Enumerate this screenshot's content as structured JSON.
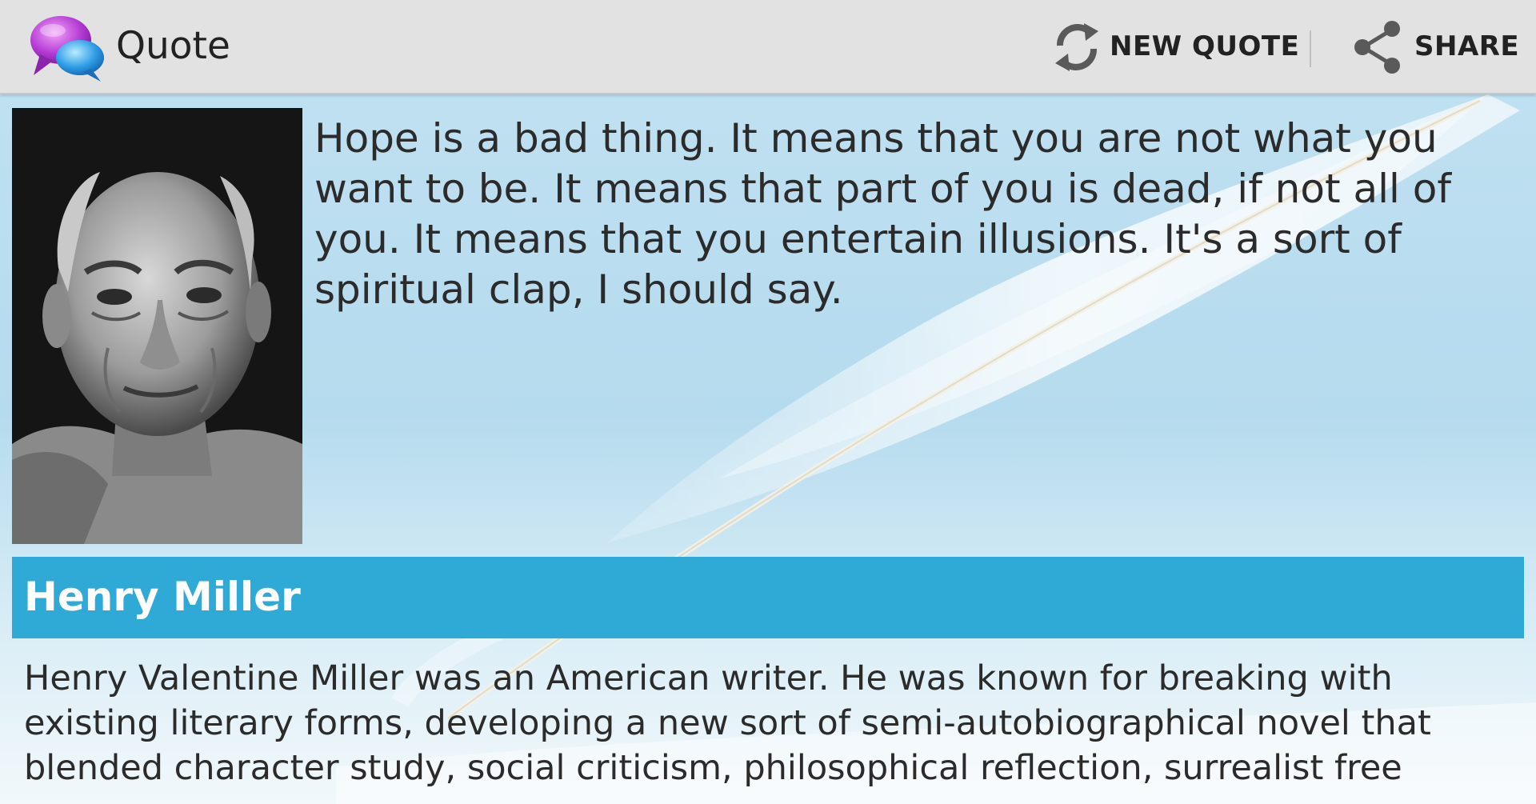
{
  "action_bar": {
    "title": "Quote",
    "new_quote_label": "NEW QUOTE",
    "share_label": "SHARE",
    "icons": {
      "app": "chat-bubbles-icon",
      "new_quote": "refresh-icon",
      "share": "share-icon"
    }
  },
  "quote": {
    "text": "Hope is a bad thing. It means that you are not what you want to be. It means that part of you is dead, if not all of you. It means that you entertain illusions. It's a sort of spiritual clap, I should say."
  },
  "author": {
    "name": "Henry Miller",
    "bio": "Henry Valentine Miller was an American writer. He was known for breaking with existing literary forms, developing a new sort of semi-autobiographical novel that blended character study, social criticism, philosophical reflection, surrealist free"
  },
  "colors": {
    "action_bar": "#e2e2e2",
    "author_bar": "#2fa9d6",
    "text": "#2b2b2b"
  }
}
